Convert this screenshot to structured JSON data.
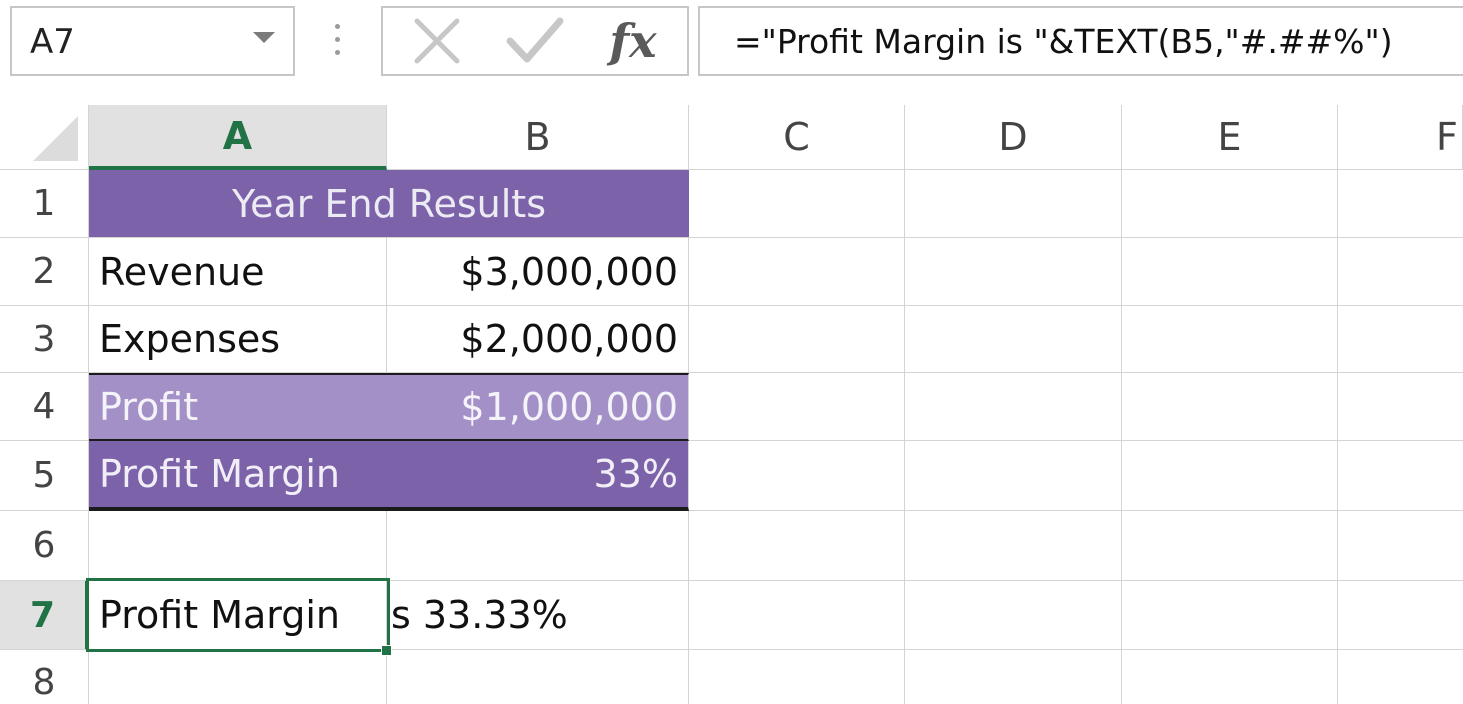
{
  "name_box": {
    "value": "A7"
  },
  "formula_bar": {
    "formula": "=\"Profit Margin is \"&TEXT(B5,\"#.##%\")"
  },
  "columns": [
    "A",
    "B",
    "C",
    "D",
    "E",
    "F"
  ],
  "rows": [
    "1",
    "2",
    "3",
    "4",
    "5",
    "6",
    "7",
    "8"
  ],
  "active_cell": {
    "column": "A",
    "row": "7"
  },
  "sheet": {
    "title": "Year End Results",
    "revenue_label": "Revenue",
    "revenue_value": "$3,000,000",
    "expenses_label": "Expenses",
    "expenses_value": "$2,000,000",
    "profit_label": "Profit",
    "profit_value": "$1,000,000",
    "margin_label": "Profit Margin",
    "margin_value": "33%",
    "a7_part1": "Profit Margin ",
    "a7_part2": "s 33.33%"
  },
  "colors": {
    "accent_green": "#217346",
    "header_purple": "#7b62a9",
    "profit_purple": "#a390c6"
  },
  "icons": {
    "cancel": "close-icon",
    "enter": "checkmark-icon",
    "insert_function": "fx-icon",
    "name_box_dropdown": "chevron-down-icon"
  },
  "labels": {
    "fx": "fx"
  }
}
